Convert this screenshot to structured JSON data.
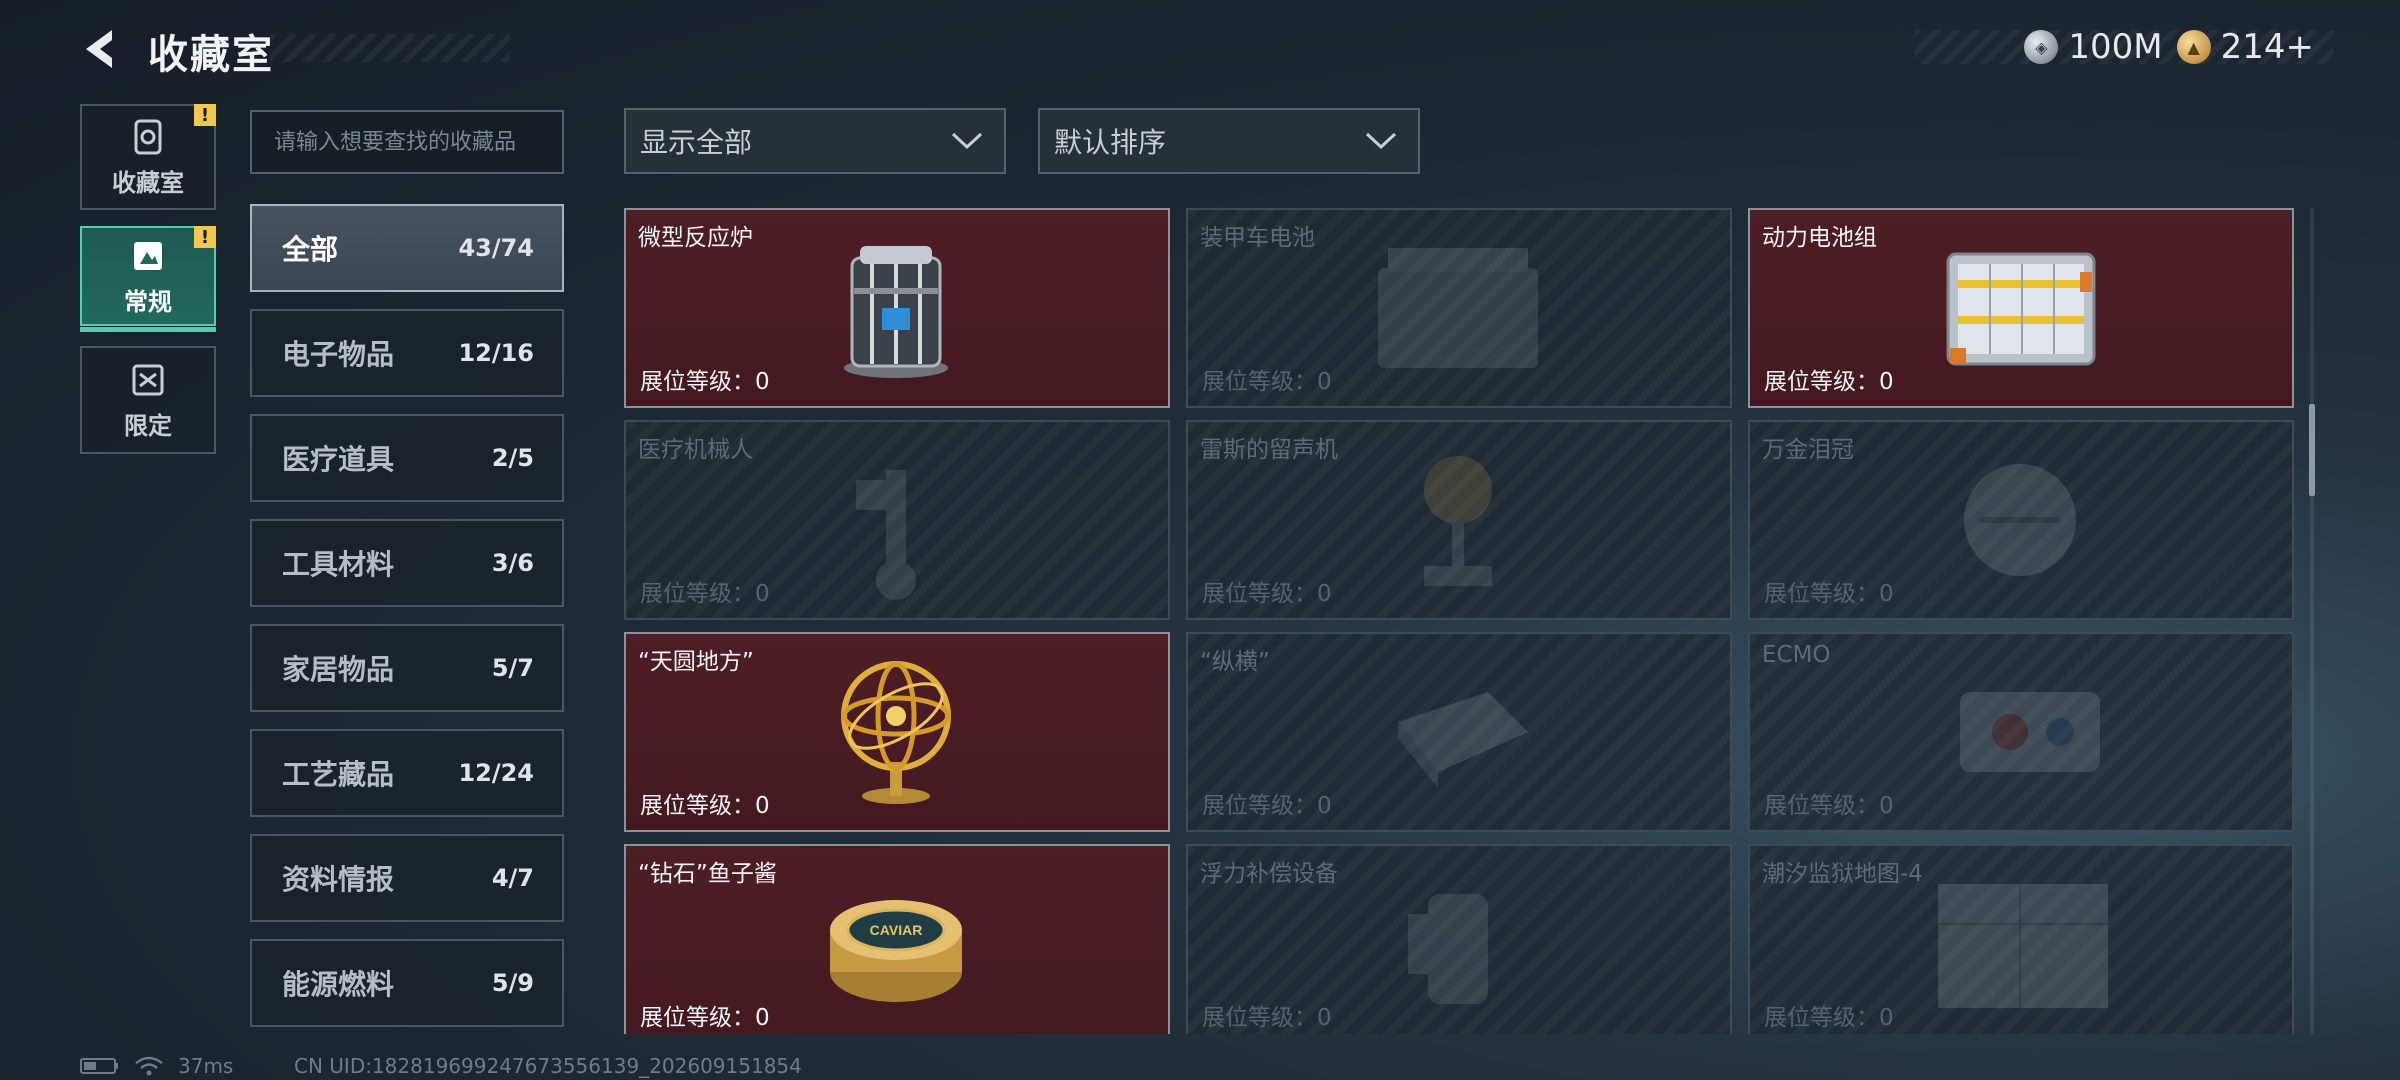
{
  "header": {
    "title": "收藏室",
    "currencies": [
      {
        "icon": "silver-coin-icon",
        "value": "100M"
      },
      {
        "icon": "gold-coin-icon",
        "value": "214+"
      }
    ]
  },
  "sidenav": [
    {
      "label": "收藏室",
      "icon": "collection-room-icon",
      "alert": "!"
    },
    {
      "label": "常规",
      "icon": "regular-icon",
      "alert": "!",
      "active": true
    },
    {
      "label": "限定",
      "icon": "limited-icon"
    }
  ],
  "search": {
    "placeholder": "请输入想要查找的收藏品"
  },
  "categories": [
    {
      "name": "全部",
      "count": "43/74",
      "active": true
    },
    {
      "name": "电子物品",
      "count": "12/16"
    },
    {
      "name": "医疗道具",
      "count": "2/5"
    },
    {
      "name": "工具材料",
      "count": "3/6"
    },
    {
      "name": "家居物品",
      "count": "5/7"
    },
    {
      "name": "工艺藏品",
      "count": "12/24"
    },
    {
      "name": "资料情报",
      "count": "4/7"
    },
    {
      "name": "能源燃料",
      "count": "5/9"
    }
  ],
  "filters": {
    "show": "显示全部",
    "sort": "默认排序"
  },
  "level_label": "展位等级：0",
  "items": [
    {
      "name": "微型反应炉",
      "owned": true,
      "icon": "micro-reactor-icon"
    },
    {
      "name": "装甲车电池",
      "owned": false,
      "icon": "armored-battery-icon"
    },
    {
      "name": "动力电池组",
      "owned": true,
      "icon": "power-battery-pack-icon"
    },
    {
      "name": "医疗机械人",
      "owned": false,
      "icon": "medical-robot-icon"
    },
    {
      "name": "雷斯的留声机",
      "owned": false,
      "icon": "phonograph-icon"
    },
    {
      "name": "万金泪冠",
      "owned": false,
      "icon": "crown-icon"
    },
    {
      "name": "“天圆地方”",
      "owned": true,
      "icon": "armillary-sphere-icon"
    },
    {
      "name": "“纵横”",
      "owned": false,
      "icon": "chessboard-icon"
    },
    {
      "name": "ECMO",
      "owned": false,
      "icon": "ecmo-machine-icon"
    },
    {
      "name": "“钻石”鱼子酱",
      "owned": true,
      "icon": "caviar-tin-icon",
      "tin_text": "CAVIAR"
    },
    {
      "name": "浮力补偿设备",
      "owned": false,
      "icon": "buoyancy-device-icon"
    },
    {
      "name": "潮汐监狱地图-4",
      "owned": false,
      "icon": "prison-map-icon"
    }
  ],
  "footer": {
    "ping": "37ms",
    "uid": "CN UID:182819699247673556139_202609151854"
  }
}
